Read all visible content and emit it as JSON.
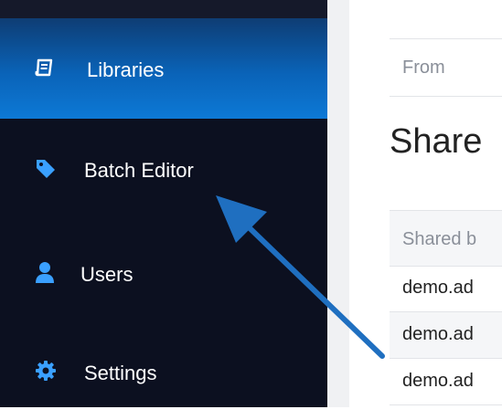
{
  "sidebar": {
    "items": [
      {
        "label": "Libraries",
        "icon": "book-icon",
        "active": true
      },
      {
        "label": "Batch Editor",
        "icon": "tag-icon",
        "active": false
      },
      {
        "label": "Users",
        "icon": "user-icon",
        "active": false
      },
      {
        "label": "Settings",
        "icon": "gear-icon",
        "active": false
      }
    ]
  },
  "main": {
    "from_label": "From",
    "title": "Share",
    "table": {
      "header": "Shared b",
      "rows": [
        "demo.ad",
        "demo.ad",
        "demo.ad"
      ]
    }
  },
  "colors": {
    "sidebar_bg": "#0c1020",
    "active_item": "#0a63b8",
    "icon_blue": "#3aa0ff",
    "arrow": "#1f6fc0"
  }
}
